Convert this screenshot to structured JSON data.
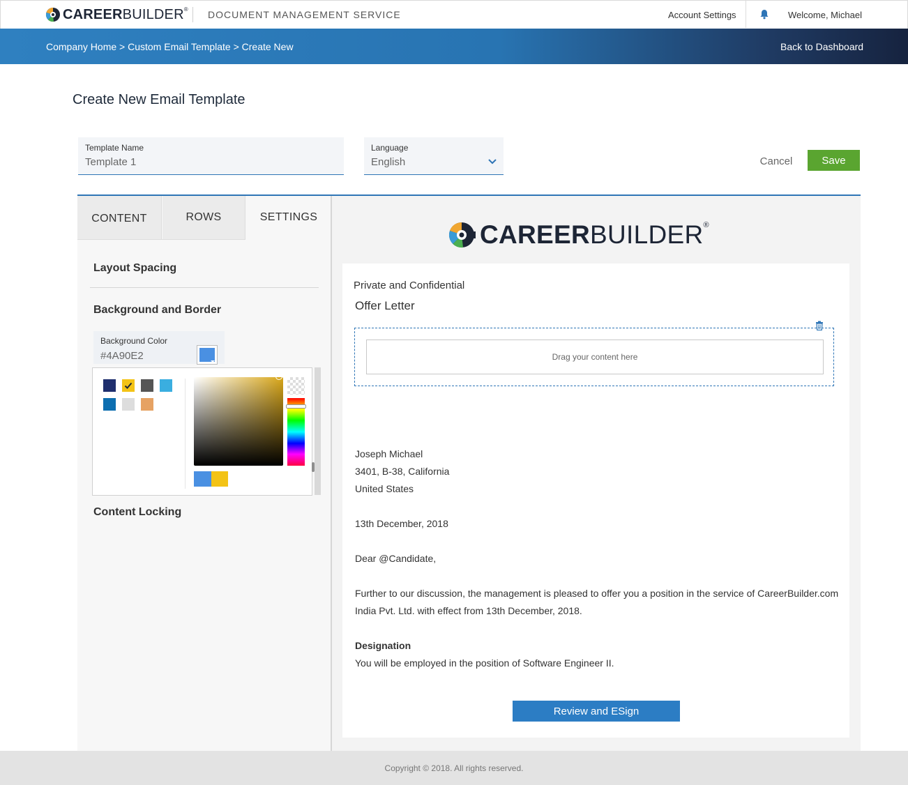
{
  "header": {
    "logo_bold": "CAREER",
    "logo_light": "BUILDER",
    "logo_reg": "®",
    "service_title": "DOCUMENT MANAGEMENT SERVICE",
    "account_settings": "Account Settings",
    "welcome": "Welcome, Michael"
  },
  "nav": {
    "breadcrumb": "Company Home > Custom Email Template > Create New",
    "back_to_dashboard": "Back to Dashboard"
  },
  "page": {
    "title": "Create New Email Template"
  },
  "form": {
    "template_name_label": "Template Name",
    "template_name_value": "Template 1",
    "language_label": "Language",
    "language_value": "English",
    "cancel_label": "Cancel",
    "save_label": "Save"
  },
  "sidebar": {
    "tabs": [
      {
        "label": "CONTENT"
      },
      {
        "label": "ROWS"
      },
      {
        "label": "SETTINGS"
      }
    ],
    "layout_spacing": "Layout Spacing",
    "background_border": "Background and Border",
    "bg_color_label": "Background Color",
    "bg_color_value": "#4A90E2",
    "content_locking": "Content Locking"
  },
  "color_picker": {
    "swatches": [
      "#1f2f6e",
      "#f3c316",
      "#555555",
      "#3aaee0",
      "#0d6eb0",
      "#dddddd",
      "#e6a263"
    ],
    "selected_swatch": "#f3c316",
    "hue": "#d9a71a",
    "current_color": "#4A90E2",
    "new_color": "#f3c316"
  },
  "preview": {
    "private": "Private and Confidential",
    "offer_letter": "Offer Letter",
    "drop_placeholder": "Drag your content here",
    "name": "Joseph Michael",
    "address1": "3401, B-38, California",
    "address2": "United States",
    "date": "13th December, 2018",
    "greeting": "Dear @Candidate,",
    "para_line1": "Further to our discussion, the management is pleased to offer you a position in the service of CareerBuilder.com",
    "para_line2": "India Pvt. Ltd. with effect from 13th December, 2018.",
    "designation_heading": "Designation",
    "designation_text": "You will be employed in the position of Software Engineer II.",
    "esign_button": "Review and ESign"
  },
  "footer": {
    "copyright": "Copyright © 2018. All rights reserved."
  },
  "colors": {
    "accent_blue": "#2e75b6",
    "save_green": "#5aa530",
    "esign_blue": "#2c7dc4"
  }
}
